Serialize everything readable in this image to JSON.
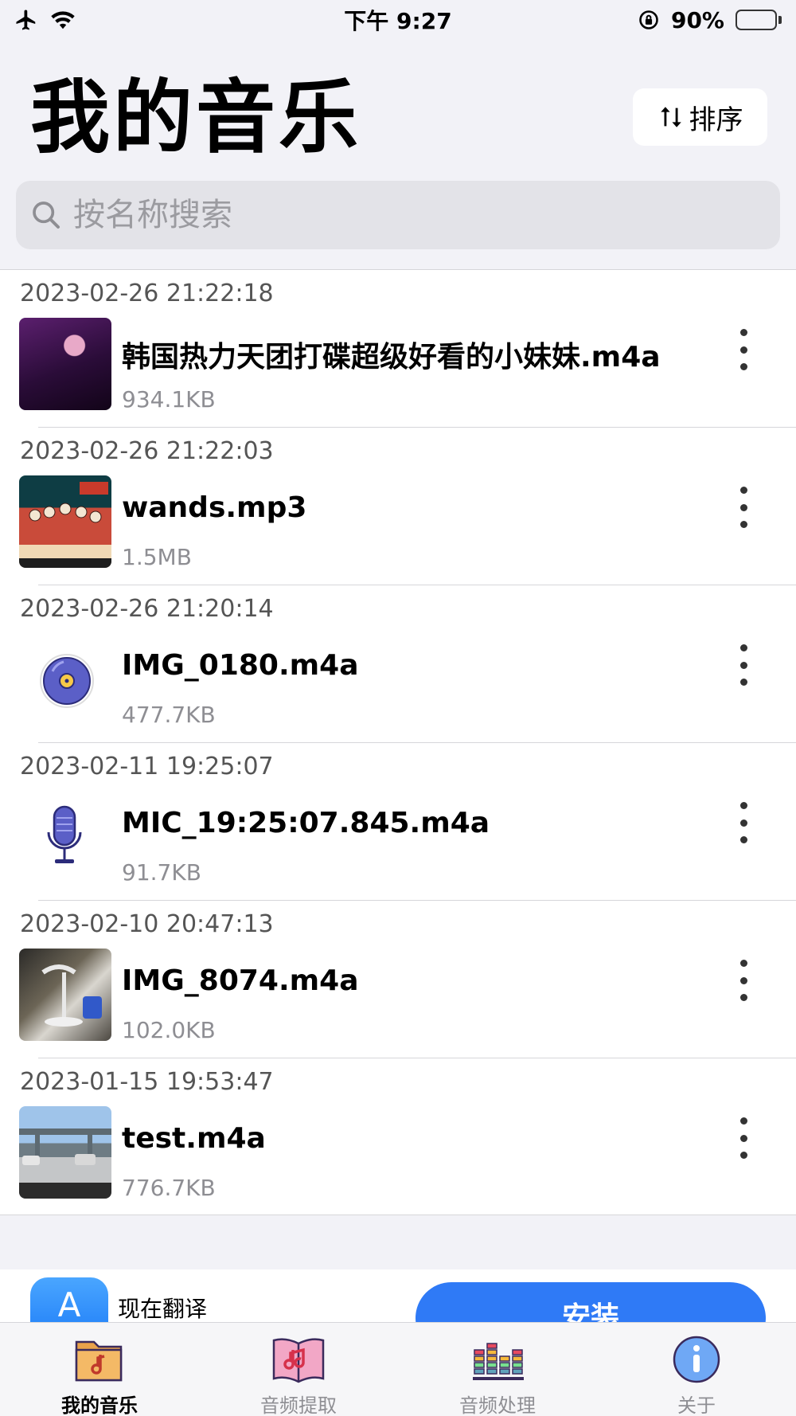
{
  "status_bar": {
    "time": "下午 9:27",
    "battery_percent": "90%",
    "battery_level": 0.9,
    "icons": [
      "airplane-icon",
      "wifi-icon",
      "rotation-lock-icon",
      "battery-charging-icon"
    ]
  },
  "header": {
    "title": "我的音乐",
    "sort_label": "排序"
  },
  "search": {
    "placeholder": "按名称搜索"
  },
  "files": [
    {
      "date": "2023-02-26 21:22:18",
      "name": "韩国热力天团打碟超级好看的小妹妹.m4a",
      "size": "934.1KB",
      "thumb": "video-thumbnail"
    },
    {
      "date": "2023-02-26 21:22:03",
      "name": "wands.mp3",
      "size": "1.5MB",
      "thumb": "album-art"
    },
    {
      "date": "2023-02-26 21:20:14",
      "name": "IMG_0180.m4a",
      "size": "477.7KB",
      "thumb": "vinyl-disc-icon"
    },
    {
      "date": "2023-02-11 19:25:07",
      "name": "MIC_19:25:07.845.m4a",
      "size": "91.7KB",
      "thumb": "microphone-icon"
    },
    {
      "date": "2023-02-10 20:47:13",
      "name": "IMG_8074.m4a",
      "size": "102.0KB",
      "thumb": "video-thumbnail"
    },
    {
      "date": "2023-01-15 19:53:47",
      "name": "test.m4a",
      "size": "776.7KB",
      "thumb": "video-thumbnail"
    }
  ],
  "ad": {
    "title": "现在翻译",
    "install_label": "安装",
    "icon_letter": "A"
  },
  "tabs": [
    {
      "label": "我的音乐",
      "icon": "music-folder-icon",
      "active": true
    },
    {
      "label": "音频提取",
      "icon": "music-book-icon",
      "active": false
    },
    {
      "label": "音频处理",
      "icon": "equalizer-icon",
      "active": false
    },
    {
      "label": "关于",
      "icon": "info-icon",
      "active": false
    }
  ],
  "colors": {
    "background": "#f2f2f7",
    "accent": "#2f7af6",
    "disc_purple": "#5b5fc7"
  }
}
